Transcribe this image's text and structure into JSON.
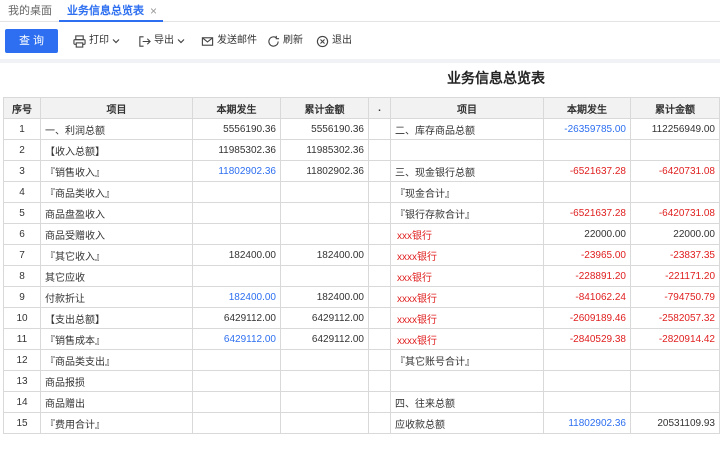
{
  "tabs": {
    "home": "我的桌面",
    "active": "业务信息总览表",
    "close": "×"
  },
  "toolbar": {
    "query": "查 询",
    "print": "打印",
    "export": "导出",
    "send_mail": "发送邮件",
    "refresh": "刷新",
    "exit": "退出"
  },
  "report": {
    "title": "业务信息总览表",
    "headers": [
      "序号",
      "项目",
      "本期发生",
      "累计金额",
      ".",
      "项目",
      "本期发生",
      "累计金额"
    ],
    "rows": [
      {
        "no": "1",
        "item": "一、利润总额",
        "cur": "5556190.36",
        "total": "5556190.36",
        "item2": "二、库存商品总额",
        "cur2": "-26359785.00",
        "total2": "112256949.00"
      },
      {
        "no": "2",
        "item": "【收入总额】",
        "cur": "11985302.36",
        "total": "11985302.36",
        "item2": "",
        "cur2": "",
        "total2": ""
      },
      {
        "no": "3",
        "item": "『销售收入』",
        "cur": "11802902.36",
        "total": "11802902.36",
        "item2": "三、现金银行总额",
        "cur2": "-6521637.28",
        "total2": "-6420731.08"
      },
      {
        "no": "4",
        "item": "『商品类收入』",
        "cur": "",
        "total": "",
        "item2": "『现金合计』",
        "cur2": "",
        "total2": ""
      },
      {
        "no": "5",
        "item": "商品盘盈收入",
        "cur": "",
        "total": "",
        "item2": "『银行存款合计』",
        "cur2": "-6521637.28",
        "total2": "-6420731.08"
      },
      {
        "no": "6",
        "item": "商品受赠收入",
        "cur": "",
        "total": "",
        "item2": "xxx银行",
        "cur2": "22000.00",
        "total2": "22000.00"
      },
      {
        "no": "7",
        "item": "『其它收入』",
        "cur": "182400.00",
        "total": "182400.00",
        "item2": "xxxx银行",
        "cur2": "-23965.00",
        "total2": "-23837.35"
      },
      {
        "no": "8",
        "item": "其它应收",
        "cur": "",
        "total": "",
        "item2": "xxx银行",
        "cur2": "-228891.20",
        "total2": "-221171.20"
      },
      {
        "no": "9",
        "item": "付款折让",
        "cur": "182400.00",
        "total": "182400.00",
        "item2": "xxxx银行",
        "cur2": "-841062.24",
        "total2": "-794750.79"
      },
      {
        "no": "10",
        "item": "【支出总额】",
        "cur": "6429112.00",
        "total": "6429112.00",
        "item2": "xxxx银行",
        "cur2": "-2609189.46",
        "total2": "-2582057.32"
      },
      {
        "no": "11",
        "item": "『销售成本』",
        "cur": "6429112.00",
        "total": "6429112.00",
        "item2": "xxxx银行",
        "cur2": "-2840529.38",
        "total2": "-2820914.42"
      },
      {
        "no": "12",
        "item": "『商品类支出』",
        "cur": "",
        "total": "",
        "item2": "『其它账号合计』",
        "cur2": "",
        "total2": ""
      },
      {
        "no": "13",
        "item": "商品报损",
        "cur": "",
        "total": "",
        "item2": "",
        "cur2": "",
        "total2": ""
      },
      {
        "no": "14",
        "item": "商品赠出",
        "cur": "",
        "total": "",
        "item2": "四、往来总额",
        "cur2": "",
        "total2": ""
      },
      {
        "no": "15",
        "item": "『费用合计』",
        "cur": "",
        "total": "",
        "item2": "应收款总额",
        "cur2": "11802902.36",
        "total2": "20531109.93"
      }
    ]
  },
  "colors": {
    "accent": "#2d6ff0",
    "negative": "#e02020"
  }
}
